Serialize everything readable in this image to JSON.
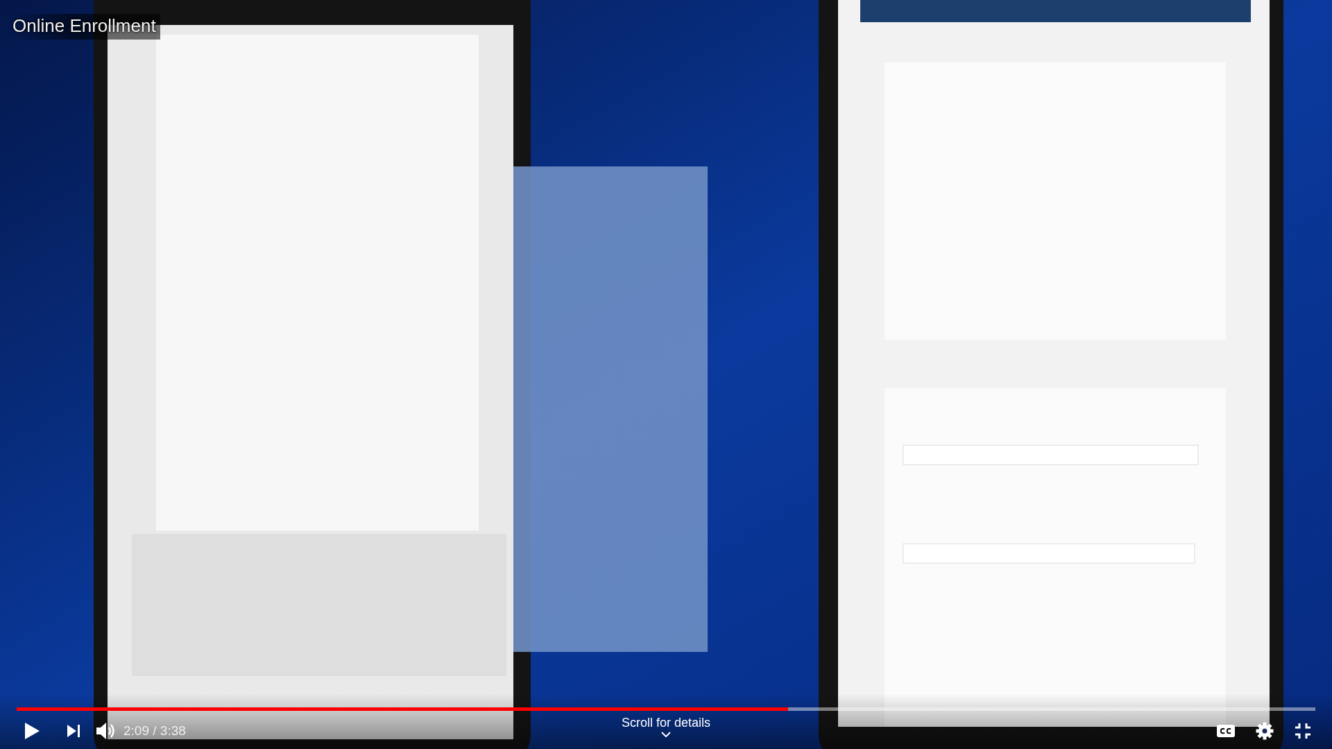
{
  "video": {
    "title": "Online Enrollment"
  },
  "player": {
    "progress": {
      "level": 0.594
    },
    "time": "2:09 / 3:38",
    "scroll_hint": "Scroll for details",
    "captions_on": false
  }
}
